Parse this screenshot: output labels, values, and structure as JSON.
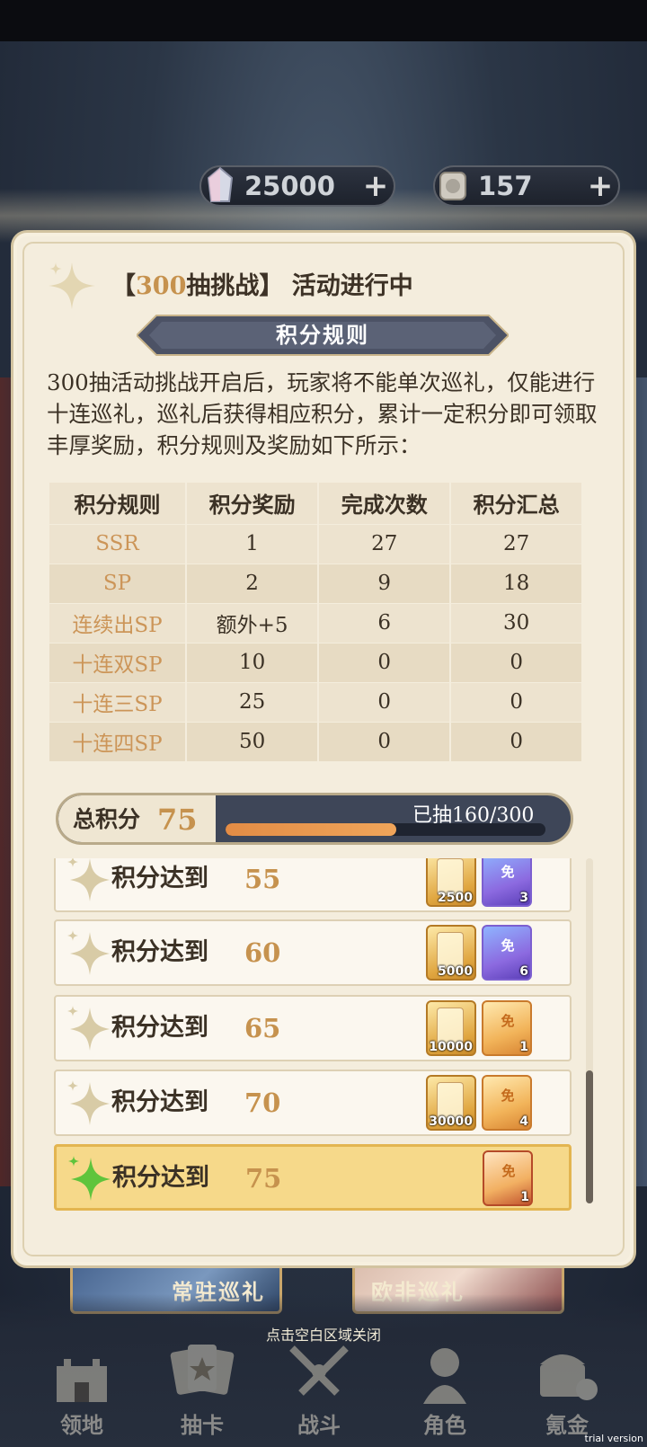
{
  "currency": [
    {
      "icon": "crystal-icon",
      "value": "25000",
      "plus": "+"
    },
    {
      "icon": "scroll-ticket-icon",
      "value": "157",
      "plus": "+"
    }
  ],
  "panel": {
    "title_prefix": "【",
    "title_number": "300",
    "title_suffix": "抽挑战】 活动进行中",
    "rules_header": "积分规则",
    "description": "300抽活动挑战开启后，玩家将不能单次巡礼，仅能进行十连巡礼，巡礼后获得相应积分，累计一定积分即可领取丰厚奖励，积分规则及奖励如下所示：",
    "table": {
      "headers": [
        "积分规则",
        "积分奖励",
        "完成次数",
        "积分汇总"
      ],
      "rows": [
        [
          "SSR",
          "1",
          "27",
          "27"
        ],
        [
          "SP",
          "2",
          "9",
          "18"
        ],
        [
          "连续出SP",
          "额外+5",
          "6",
          "30"
        ],
        [
          "十连双SP",
          "10",
          "0",
          "0"
        ],
        [
          "十连三SP",
          "25",
          "0",
          "0"
        ],
        [
          "十连四SP",
          "50",
          "0",
          "0"
        ]
      ]
    },
    "total": {
      "label": "总积分",
      "value": "75",
      "drawn_label": "已抽160/300",
      "progress": 0.533
    },
    "rewards": [
      {
        "label": "积分达到",
        "value": "55",
        "active": false,
        "items": [
          {
            "type": "gold",
            "qty": "2500"
          },
          {
            "type": "purple",
            "glyph": "免",
            "qty": "3"
          }
        ]
      },
      {
        "label": "积分达到",
        "value": "60",
        "active": false,
        "items": [
          {
            "type": "gold",
            "qty": "5000"
          },
          {
            "type": "purple",
            "glyph": "免",
            "qty": "6"
          }
        ]
      },
      {
        "label": "积分达到",
        "value": "65",
        "active": false,
        "items": [
          {
            "type": "gold",
            "qty": "10000"
          },
          {
            "type": "orange",
            "glyph": "免",
            "qty": "1"
          }
        ]
      },
      {
        "label": "积分达到",
        "value": "70",
        "active": false,
        "items": [
          {
            "type": "gold",
            "qty": "30000"
          },
          {
            "type": "orange",
            "glyph": "免",
            "qty": "4"
          }
        ]
      },
      {
        "label": "积分达到",
        "value": "75",
        "active": true,
        "items": [
          {
            "type": "red",
            "glyph": "免",
            "qty": "1"
          }
        ]
      }
    ]
  },
  "banners": [
    {
      "label": "常驻巡礼"
    },
    {
      "label": "欧非巡礼"
    }
  ],
  "nav": [
    {
      "label": "领地",
      "icon": "castle-icon"
    },
    {
      "label": "抽卡",
      "icon": "cards-icon"
    },
    {
      "label": "战斗",
      "icon": "crossed-swords-icon"
    },
    {
      "label": "角色",
      "icon": "character-icon"
    },
    {
      "label": "氪金",
      "icon": "treasure-chest-icon"
    }
  ],
  "close_hint": "点击空白区域关闭",
  "watermark": "trial version",
  "colors": {
    "accent_gold": "#c6924e",
    "panel_bg": "#f4eddd",
    "active_row": "#f6d98a",
    "progress": "#e38c45"
  }
}
